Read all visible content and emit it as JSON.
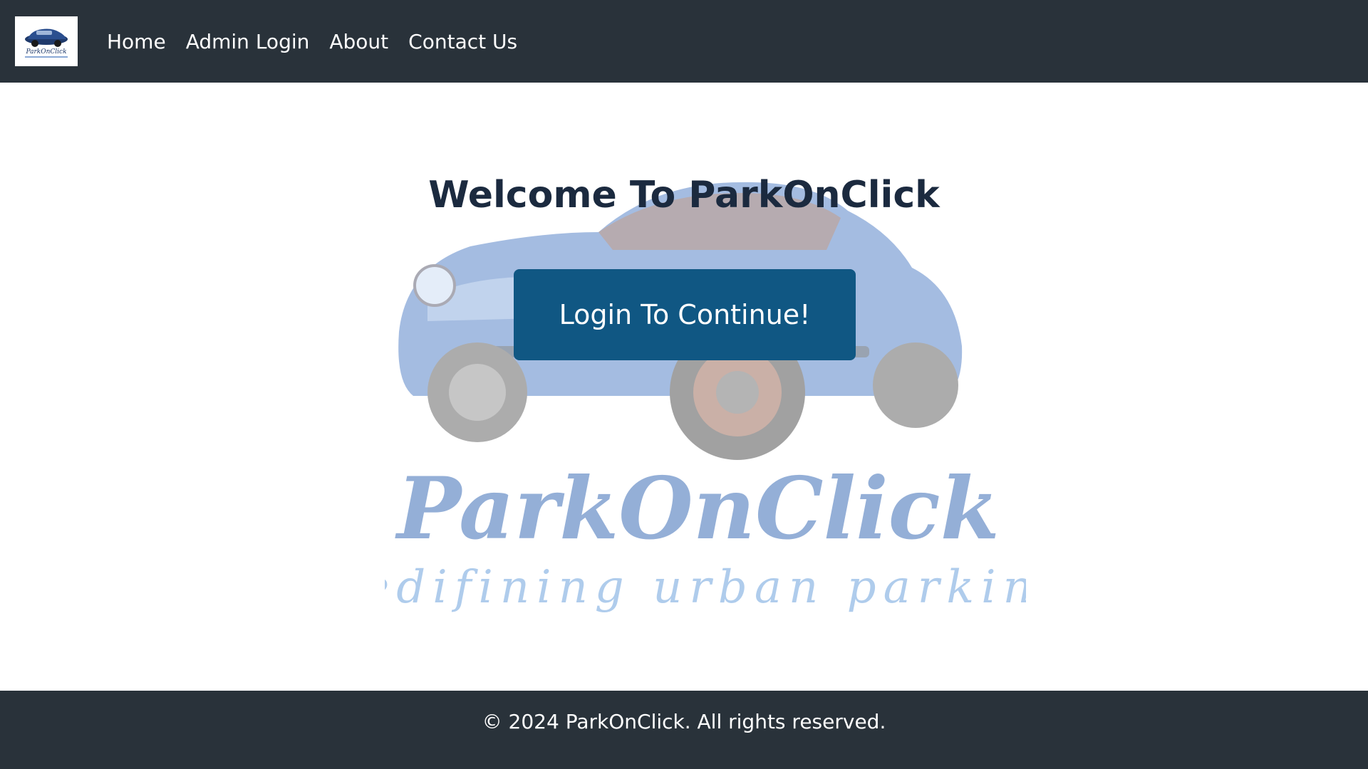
{
  "nav": {
    "logo_alt": "ParkOnClick",
    "links": [
      {
        "label": "Home"
      },
      {
        "label": "Admin Login"
      },
      {
        "label": "About"
      },
      {
        "label": "Contact Us"
      }
    ]
  },
  "hero": {
    "title": "Welcome To ParkOnClick",
    "login_button": "Login To Continue!",
    "watermark_brand": "ParkOnClick",
    "watermark_tagline": "Redifining urban parking"
  },
  "footer": {
    "copyright": "© 2024 ParkOnClick. All rights reserved."
  },
  "colors": {
    "nav_bg": "#29323a",
    "button_bg": "#105783",
    "title_text": "#1b2a3f",
    "footer_bg": "#29323a"
  }
}
